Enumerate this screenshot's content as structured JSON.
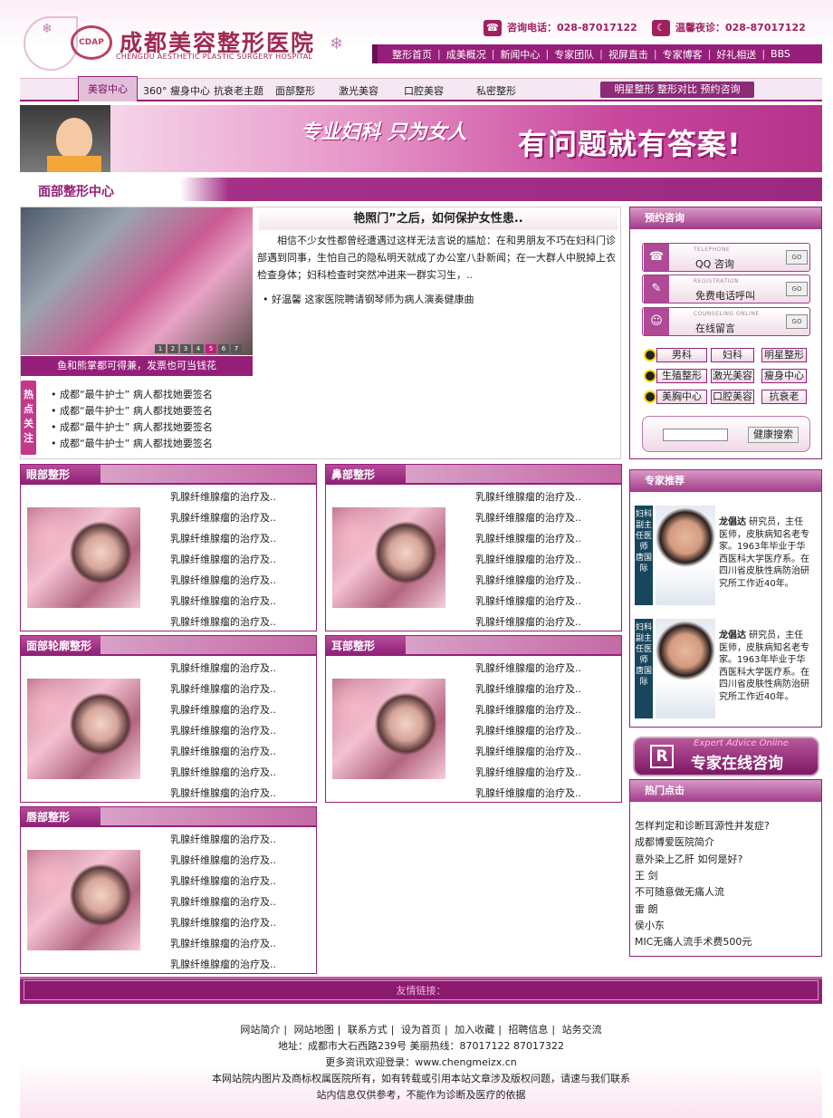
{
  "header": {
    "logo_seal": "CDAP",
    "logo_name": "成都美容整形医院",
    "logo_en": "CHENGDU AESTHETIC PLASTIC SURGERY HOSPITAL",
    "hotline_label": "咨询电话：028-87017122",
    "night_label": "温馨夜诊：028-87017122",
    "nav": [
      "整形首页",
      "成美概况",
      "新闻中心",
      "专家团队",
      "视屏直击",
      "专家博客",
      "好礼相送",
      "BBS"
    ]
  },
  "nav2": {
    "active": "美容中心",
    "items": [
      "360° 瘦身中心",
      "抗衰老主题",
      "面部整形",
      "激光美容",
      "口腔美容",
      "私密整形"
    ],
    "right": "明星整形  整形对比  预约咨询"
  },
  "banner": {
    "slogan1": "专业妇科 只为女人",
    "slogan2": "有问题就有答案!"
  },
  "section_title": "面部整形中心",
  "feature": {
    "pages": [
      "1",
      "2",
      "3",
      "4",
      "5",
      "6",
      "7"
    ],
    "caption": "鱼和熊掌都可得兼，发票也可当钱花",
    "title": "艳照门”之后，如何保护女性患..",
    "body": "相信不少女性都曾经遭遇过这样无法言说的尴尬：在和男朋友不巧在妇科门诊部遇到同事，生怕自己的隐私明天就成了办公室八卦新闻；在一大群人中脱掉上衣检查身体；妇科检查时突然冲进来一群实习生，..",
    "bullet": "• 好温馨  这家医院聘请钢琴师为病人演奏健康曲",
    "hot_label": "热点关注",
    "hot_items": [
      "• 成都“最牛护士”   病人都找她要签名",
      "• 成都“最牛护士”   病人都找她要签名",
      "• 成都“最牛护士”   病人都找她要签名",
      "• 成都“最牛护士”   病人都找她要签名"
    ]
  },
  "categories": [
    {
      "title": "眼部整形"
    },
    {
      "title": "鼻部整形"
    },
    {
      "title": "面部轮廓整形"
    },
    {
      "title": "耳部整形"
    },
    {
      "title": "唇部整形"
    }
  ],
  "cat_item": "乳腺纤维腺瘤的治疗及..",
  "consult": {
    "title": "预约咨询",
    "items": [
      {
        "en": "TELEPHONE",
        "label": "QQ 咨询",
        "icon": "☎"
      },
      {
        "en": "REGISTRATION",
        "label": "免费电话呼叫",
        "icon": "✎"
      },
      {
        "en": "COUNSELING ONLINE",
        "label": "在线留言",
        "icon": "☺"
      }
    ],
    "go": "GO",
    "keywords": [
      "男科",
      "妇科",
      "明星整形",
      "生殖整形",
      "激光美容",
      "瘦身中心",
      "美胸中心",
      "口腔美容",
      "抗衰老"
    ],
    "search_btn": "健康搜索"
  },
  "experts": {
    "title": "专家推荐",
    "list": [
      {
        "side": "妇科 副主任医师 唐国际",
        "name": "龙倡达",
        "desc": " 研究员，主任医师，皮肤病知名老专家。1963年毕业于华西医科大学医疗系。在四川省皮肤性病防治研究所工作近40年。"
      },
      {
        "side": "妇科 副主任医师 唐国际",
        "name": "龙倡达",
        "desc": " 研究员，主任医师，皮肤病知名老专家。1963年毕业于华西医科大学医疗系。在四川省皮肤性病防治研究所工作近40年。"
      }
    ],
    "online_en": "Expert Advice Online",
    "online_cn": "专家在线咨询",
    "online_icon": "R"
  },
  "hot_clicks": {
    "title": "热门点击",
    "items": [
      "怎样判定和诊断耳源性并发症?",
      "成都博爱医院简介",
      "意外染上乙肝 如何是好?",
      "王 剑",
      "不可随意做无痛人流",
      "雷 朗",
      "侯小东",
      "MIC无痛人流手术费500元"
    ]
  },
  "links_label": "友情链接：",
  "footer": {
    "links": [
      "网站简介",
      "网站地图",
      "联系方式",
      "设为首页",
      "加入收藏",
      "招聘信息",
      "站务交流"
    ],
    "address": "地址：成都市大石西路239号 美丽热线：87017122 87017322",
    "more": "更多资讯欢迎登录：www.chengmeizx.cn",
    "copyright": "本网站院内图片及商标权属医院所有，如有转载或引用本站文章涉及版权问题，请速与我们联系",
    "disclaimer": "站内信息仅供参考，不能作为诊断及医疗的依据"
  }
}
